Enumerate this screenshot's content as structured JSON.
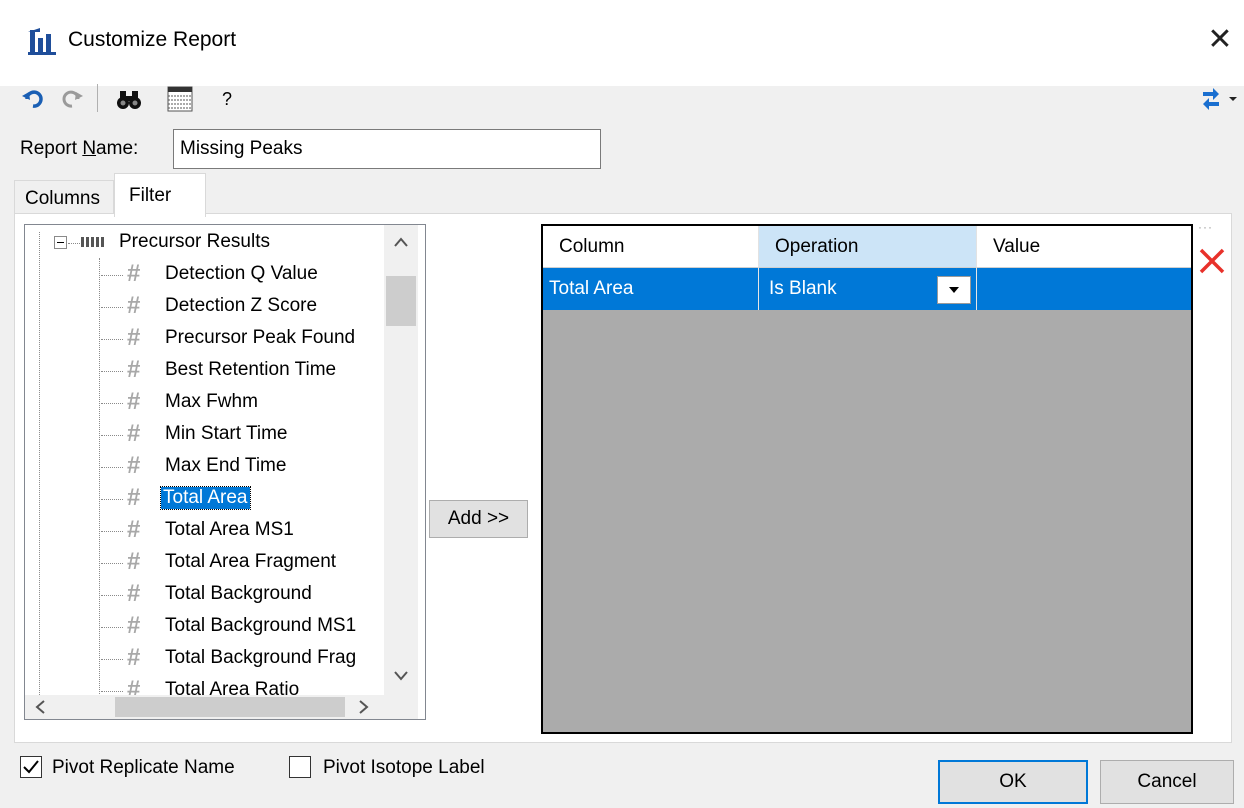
{
  "window": {
    "title": "Customize Report",
    "close": "✕"
  },
  "toolbar": {
    "help": "?"
  },
  "report_name": {
    "label": "Report ",
    "label_accel": "N",
    "label_rest": "ame:",
    "value": "Missing Peaks"
  },
  "tabs": {
    "columns": "Columns",
    "filter": "Filter"
  },
  "tree": {
    "root": "Precursor Results",
    "items": [
      "Detection Q Value",
      "Detection Z Score",
      "Precursor Peak Found",
      "Best Retention Time",
      "Max Fwhm",
      "Min Start Time",
      "Max End Time",
      "Total Area",
      "Total Area MS1",
      "Total Area Fragment",
      "Total Background",
      "Total Background MS1",
      "Total Background Frag",
      "Total Area Ratio"
    ],
    "selected": "Total Area"
  },
  "add_button": "Add >>",
  "filter_grid": {
    "headers": [
      "Column",
      "Operation",
      "Value"
    ],
    "rows": [
      {
        "column": "Total Area",
        "operation": "Is Blank",
        "value": ""
      }
    ]
  },
  "pivot": {
    "replicate_label": "Pivot Replicate Name",
    "replicate_checked": true,
    "isotope_label": "Pivot Isotope Label",
    "isotope_checked": false
  },
  "buttons": {
    "ok": "OK",
    "cancel": "Cancel"
  },
  "colors": {
    "selection": "#0078d7",
    "delete": "#e8312a",
    "grid_bg": "#ababab"
  }
}
